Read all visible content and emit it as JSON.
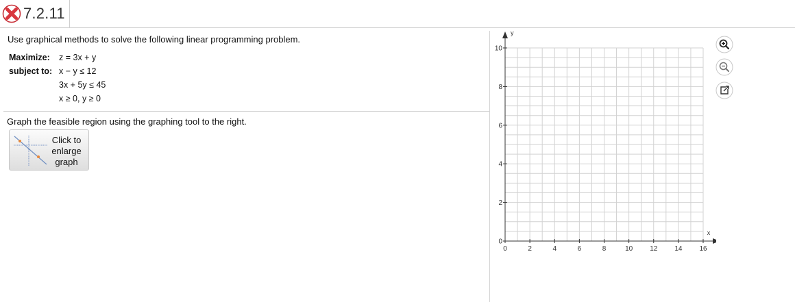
{
  "header": {
    "problem_id": "7.2.11",
    "status_icon": "incorrect-x-icon",
    "status_color": "#d9363e"
  },
  "problem": {
    "instructions": "Use graphical methods to solve the following linear programming problem.",
    "maximize_label": "Maximize:",
    "objective": "z = 3x + y",
    "subject_to_label": "subject to:",
    "constraints": [
      "x − y ≤ 12",
      "3x + 5y ≤ 45",
      "x ≥ 0, y ≥ 0"
    ]
  },
  "graph_section": {
    "instructions": "Graph the feasible region using the graphing tool to the right.",
    "enlarge_button": [
      "Click to",
      "enlarge",
      "graph"
    ]
  },
  "graph": {
    "x_label": "x",
    "y_label": "y",
    "x_ticks": [
      "0",
      "2",
      "4",
      "6",
      "8",
      "10",
      "12",
      "14",
      "16"
    ],
    "y_ticks": [
      "0",
      "2",
      "4",
      "6",
      "8",
      "10"
    ],
    "x_range": [
      0,
      16
    ],
    "y_range": [
      0,
      10
    ],
    "x_step": 1,
    "y_step": 0.5,
    "grid": true
  },
  "tools": [
    "zoom-in-icon",
    "zoom-out-icon",
    "expand-graph-icon"
  ]
}
